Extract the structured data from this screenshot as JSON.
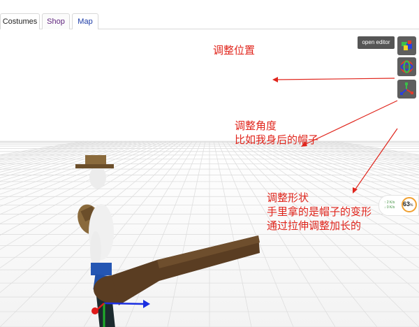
{
  "tabs": [
    {
      "label": "Costumes"
    },
    {
      "label": "Shop"
    },
    {
      "label": "Map"
    }
  ],
  "toolbar": {
    "open_editor_label": "open editor"
  },
  "tools": [
    {
      "icon": "position-gizmo-icon"
    },
    {
      "icon": "rotate-gizmo-icon"
    },
    {
      "icon": "scale-gizmo-icon"
    }
  ],
  "fps": {
    "line1": "↑ 2  K/s",
    "line2": "↓ 0  K/s",
    "value": "63",
    "unit": "%"
  },
  "annotations": {
    "position": "调整位置",
    "angle_1": "调整角度",
    "angle_2": "比如我身后的帽子",
    "shape_1": "调整形状",
    "shape_2": "手里拿的是帽子的变形",
    "shape_3": "通过拉伸调整加长的"
  },
  "colors": {
    "annotation": "#e0251c",
    "button_bg": "#555555"
  }
}
